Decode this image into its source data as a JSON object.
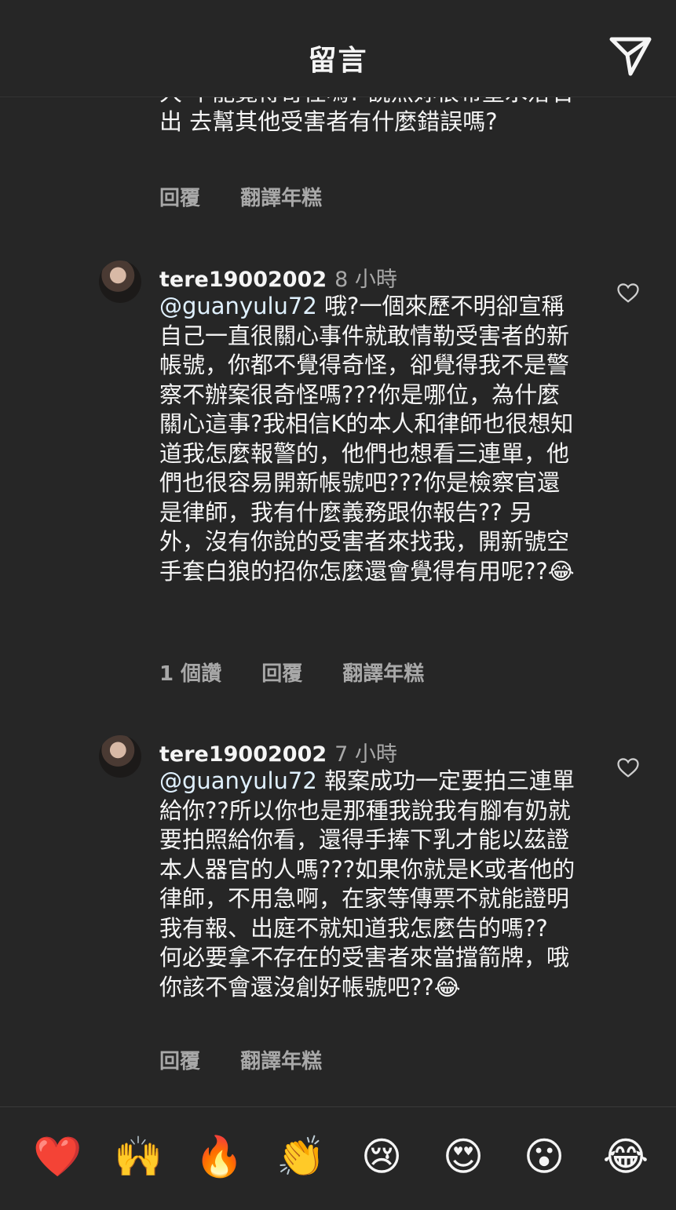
{
  "header": {
    "title": "留言"
  },
  "partial_comment": {
    "text": "大 不能覺得奇怪嗎? 說然妳很希望水落石出 去幫其他受害者有什麼錯誤嗎?",
    "actions": {
      "reply": "回覆",
      "translate": "翻譯年糕"
    }
  },
  "comments": [
    {
      "username": "tere19002002",
      "time": "8 小時",
      "mention": "@guanyulu72",
      "text": " 哦?一個來歷不明卻宣稱自己一直很關心事件就敢情勒受害者的新帳號，你都不覺得奇怪，卻覺得我不是警察不辦案很奇怪嗎???你是哪位，為什麼關心這事?我相信K的本人和律師也很想知道我怎麼報警的，他們也想看三連單，他們也很容易開新帳號吧???你是檢察官還是律師，我有什麼義務跟你報告?? 另外，沒有你說的受害者來找我，開新號空手套白狼的招你怎麼還會覺得有用呢??😂",
      "likes": "1 個讚",
      "reply": "回覆",
      "translate": "翻譯年糕"
    },
    {
      "username": "tere19002002",
      "time": "7 小時",
      "mention": "@guanyulu72",
      "text": " 報案成功一定要拍三連單給你??所以你也是那種我說我有腳有奶就要拍照給你看，還得手捧下乳才能以茲證本人器官的人嗎???如果你就是K或者他的律師，不用急啊，在家等傳票不就能證明我有報、出庭不就知道我怎麼告的嗎?? 何必要拿不存在的受害者來當擋箭牌，哦你該不會還沒創好帳號吧??😂",
      "reply": "回覆",
      "translate": "翻譯年糕"
    }
  ],
  "emoji_bar": [
    "❤️",
    "🙌",
    "🔥",
    "👏",
    "😢",
    "😍",
    "😮",
    "😂"
  ]
}
